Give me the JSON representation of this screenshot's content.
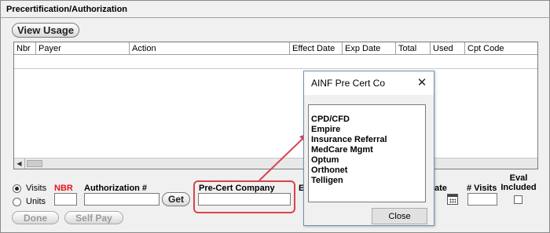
{
  "section": {
    "title": "Precertification/Authorization"
  },
  "buttons": {
    "view_usage": "View Usage",
    "get": "Get",
    "done": "Done",
    "self_pay": "Self Pay"
  },
  "grid": {
    "columns": [
      "Nbr",
      "Payer",
      "Action",
      "Effect Date",
      "Exp Date",
      "Total",
      "Used",
      "Cpt Code"
    ],
    "rows": []
  },
  "form": {
    "visits_label": "Visits",
    "units_label": "Units",
    "unit_type_selected": "Visits",
    "nbr_label": "NBR",
    "authorization_label": "Authorization #",
    "precert_company_label": "Pre-Cert Company",
    "effect_label_partial": "Ef",
    "date_label_partial": "ate",
    "visits_count_label": "# Visits",
    "eval_included_label": "Eval\nIncluded",
    "nbr_value": "",
    "authorization_value": "",
    "precert_company_value": "",
    "visits_count_value": ""
  },
  "dialog": {
    "title": "AINF Pre Cert Co",
    "close_label": "Close",
    "items": [
      "CPD/CFD",
      "Empire",
      "Insurance Referral",
      "MedCare Mgmt",
      "Optum",
      "Orthonet",
      "Telligen"
    ]
  },
  "colors": {
    "callout": "#d9434e",
    "nbr_label": "#e8141b",
    "dialog_border": "#6f8fb5"
  }
}
